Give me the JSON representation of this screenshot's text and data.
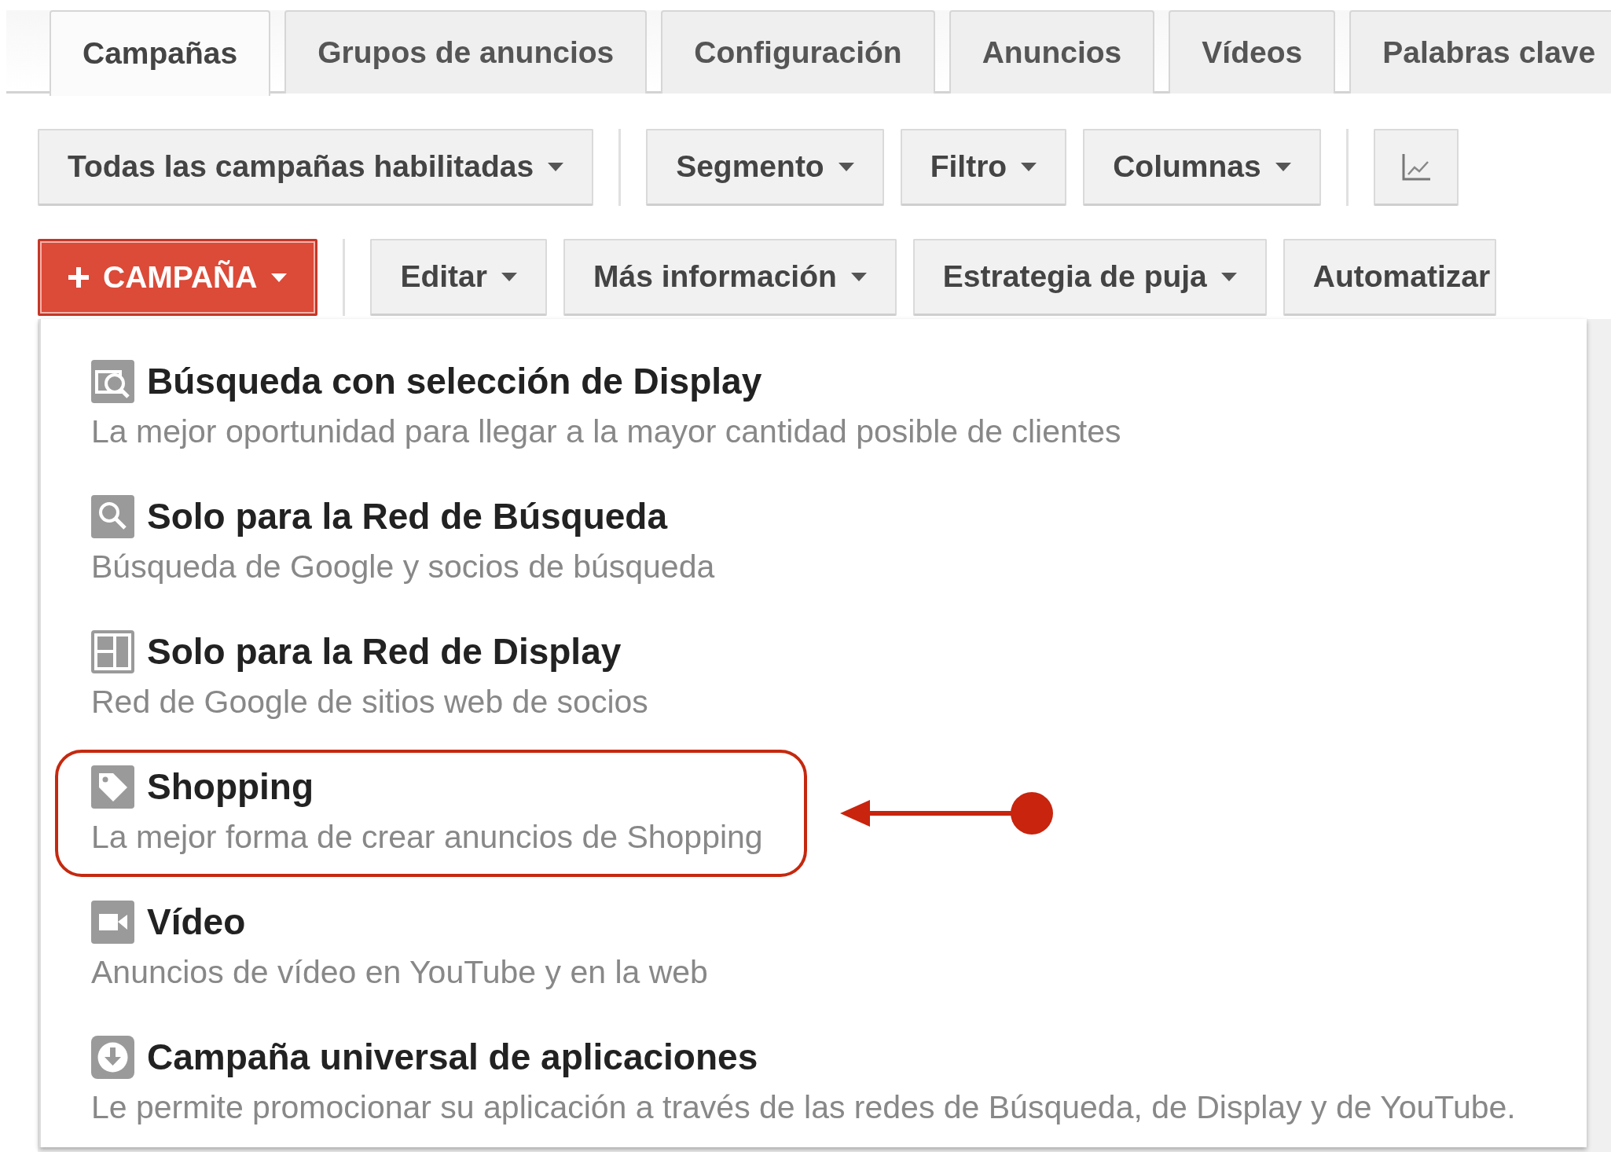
{
  "tabs": [
    {
      "label": "Campañas",
      "selected": true
    },
    {
      "label": "Grupos de anuncios",
      "selected": false
    },
    {
      "label": "Configuración",
      "selected": false
    },
    {
      "label": "Anuncios",
      "selected": false
    },
    {
      "label": "Vídeos",
      "selected": false
    },
    {
      "label": "Palabras clave",
      "selected": false
    }
  ],
  "filter_bar": [
    [
      {
        "kind": "dropdown",
        "label": "Todas las campañas habilitadas"
      }
    ],
    [
      {
        "kind": "dropdown",
        "label": "Segmento"
      },
      {
        "kind": "dropdown",
        "label": "Filtro"
      },
      {
        "kind": "dropdown",
        "label": "Columnas"
      }
    ],
    [
      {
        "kind": "chart"
      }
    ]
  ],
  "action_bar": [
    [
      {
        "kind": "primary",
        "label": "CAMPAÑA"
      }
    ],
    [
      {
        "kind": "dropdown",
        "label": "Editar"
      },
      {
        "kind": "dropdown",
        "label": "Más información"
      },
      {
        "kind": "dropdown",
        "label": "Estrategia de puja"
      },
      {
        "kind": "plain",
        "label": "Automatizar"
      }
    ]
  ],
  "campaign_menu": [
    {
      "kind": "search-display",
      "title": "Búsqueda con selección de Display",
      "description": "La mejor oportunidad para llegar a la mayor cantidad posible de clientes",
      "highlighted": false
    },
    {
      "kind": "search",
      "title": "Solo para la Red de Búsqueda",
      "description": "Búsqueda de Google y socios de búsqueda",
      "highlighted": false
    },
    {
      "kind": "display",
      "title": "Solo para la Red de Display",
      "description": "Red de Google de sitios web de socios",
      "highlighted": false
    },
    {
      "kind": "shopping",
      "title": "Shopping",
      "description": "La mejor forma de crear anuncios de Shopping",
      "highlighted": true
    },
    {
      "kind": "video",
      "title": "Vídeo",
      "description": "Anuncios de vídeo en YouTube y en la web",
      "highlighted": false
    },
    {
      "kind": "app",
      "title": "Campaña universal de aplicaciones",
      "description": "Le permite promocionar su aplicación a través de las redes de Búsqueda, de Display y de YouTube.",
      "highlighted": false
    }
  ]
}
